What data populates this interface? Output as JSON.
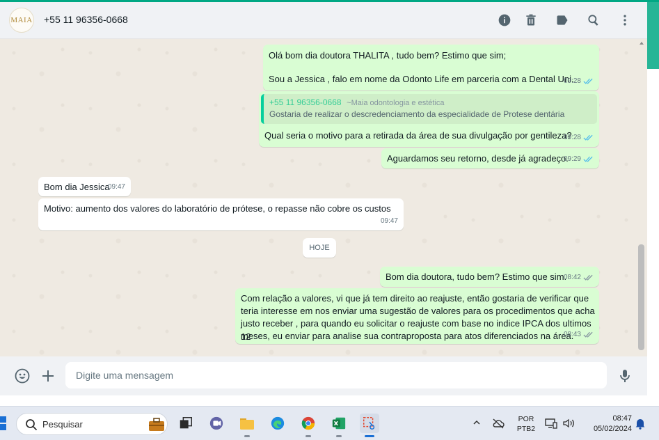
{
  "header": {
    "avatar_text": "MAIA",
    "contact_name": "+55 11 96356-0668",
    "icons": [
      "info-icon",
      "trash-icon",
      "label-icon",
      "search-icon",
      "menu-icon"
    ]
  },
  "messages": [
    {
      "id": "m1",
      "dir": "out",
      "lines": [
        "Olá bom dia doutora THALITA , tudo bem? Estimo que sim;",
        "",
        "Sou a Jessica , falo em nome da Odonto Life em parceria com a Dental Uni."
      ],
      "time": "09:28",
      "status": "read"
    },
    {
      "id": "m2",
      "dir": "out",
      "quote": {
        "sender": "+55 11 96356-0668",
        "push_name": "~Maia odontologia e estética",
        "text": "Gostaria de realizar o descredenciamento da especialidade de Protese dentária"
      },
      "lines": [
        "Qual seria o motivo para a retirada da área de sua divulgação por gentileza?"
      ],
      "time": "09:28",
      "status": "read"
    },
    {
      "id": "m3",
      "dir": "out",
      "lines": [
        "Aguardamos seu retorno, desde já agradeço."
      ],
      "time": "09:29",
      "status": "read"
    },
    {
      "id": "m4",
      "dir": "in",
      "lines": [
        "Bom dia Jessica"
      ],
      "time": "09:47"
    },
    {
      "id": "m5",
      "dir": "in",
      "lines": [
        "Motivo: aumento dos valores do laboratório de prótese, o repasse não cobre os custos"
      ],
      "time": "09:47"
    },
    {
      "id": "m6",
      "dir": "out",
      "lines": [
        "Bom dia doutora, tudo bem? Estimo que sim."
      ],
      "time": "08:42",
      "status": "delivered"
    },
    {
      "id": "m7",
      "dir": "out",
      "lines": [
        "Com relação a valores, vi que já tem direito ao reajuste, então gostaria de verificar que",
        "teria interesse em nos enviar uma sugestão de valores para os procedimentos que acha",
        "justo receber , para quando eu solicitar o reajuste com base no indice IPCA dos ultimos 12",
        "meses, eu enviar para analise sua contraproposta para atos diferenciados na área."
      ],
      "time": "08:43",
      "status": "delivered"
    }
  ],
  "date_divider": "HOJE",
  "composer": {
    "placeholder": "Digite uma mensagem"
  },
  "taskbar": {
    "search_label": "Pesquisar",
    "apps": [
      "task-view-icon",
      "teams-icon",
      "file-explorer-icon",
      "edge-icon",
      "chrome-icon",
      "excel-icon",
      "snipping-tool-icon"
    ],
    "active_app": "snipping-tool-icon",
    "lang_line1": "POR",
    "lang_line2": "PTB2",
    "time": "08:47",
    "date": "05/02/2024"
  },
  "colors": {
    "accent": "#00a884",
    "out_bubble": "#d9fdd3",
    "in_bubble": "#ffffff",
    "read_tick": "#53bdeb",
    "chat_bg": "#efeae2"
  }
}
